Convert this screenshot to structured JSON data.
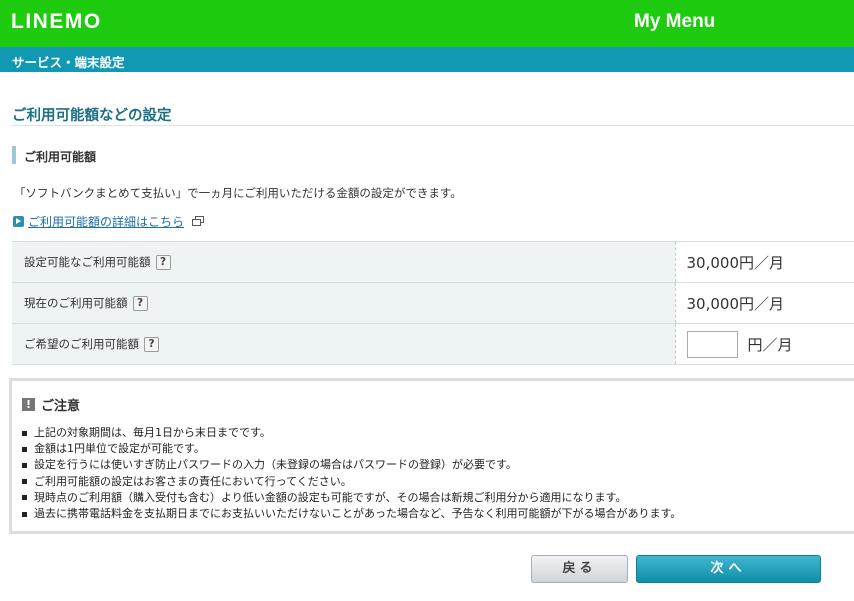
{
  "header": {
    "logo": "LINEMO",
    "menu_title": "My Menu"
  },
  "subheader": {
    "title": "サービス・端末設定"
  },
  "page": {
    "title": "ご利用可能額などの設定"
  },
  "section": {
    "title": "ご利用可能額",
    "description": "「ソフトバンクまとめて支払い」で一ヵ月にご利用いただける金額の設定ができます。",
    "detail_link": "ご利用可能額の詳細はこちら"
  },
  "help_mark": "?",
  "rows": [
    {
      "label": "設定可能なご利用可能額",
      "value": "30,000円／月"
    },
    {
      "label": "現在のご利用可能額",
      "value": "30,000円／月"
    },
    {
      "label": "ご希望のご利用可能額",
      "input_value": "",
      "unit": "円／月"
    }
  ],
  "notice": {
    "icon": "!",
    "title": "ご注意",
    "items": [
      "上記の対象期間は、毎月1日から末日までです。",
      "金額は1円単位で設定が可能です。",
      "設定を行うには使いすぎ防止パスワードの入力（未登録の場合はパスワードの登録）が必要です。",
      "ご利用可能額の設定はお客さまの責任において行ってください。",
      "現時点のご利用額（購入受付も含む）より低い金額の設定も可能ですが、その場合は新規ご利用分から適用になります。",
      "過去に携帯電話料金を支払期日までにお支払いいただけないことがあった場合など、予告なく利用可能額が下がる場合があります。"
    ]
  },
  "buttons": {
    "back": "戻る",
    "next": "次へ"
  },
  "colors": {
    "header_green": "#1ecb0f",
    "subheader_teal": "#1199b4",
    "title_teal": "#1d6f86"
  }
}
